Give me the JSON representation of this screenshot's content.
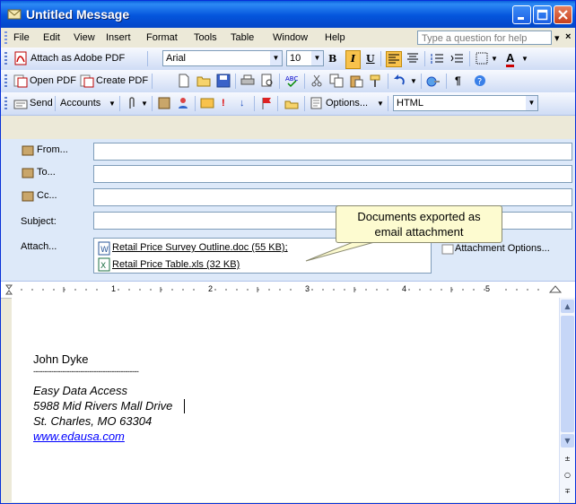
{
  "window": {
    "title": "Untitled Message"
  },
  "menu": [
    "File",
    "Edit",
    "View",
    "Insert",
    "Format",
    "Tools",
    "Table",
    "Window",
    "Help"
  ],
  "ask_placeholder": "Type a question for help",
  "toolbar1": {
    "attach_pdf": "Attach as Adobe PDF",
    "font": "Arial",
    "size": "10"
  },
  "toolbar2": {
    "open_pdf": "Open PDF",
    "create_pdf": "Create PDF"
  },
  "toolbar3": {
    "send": "Send",
    "accounts": "Accounts",
    "options": "Options...",
    "format": "HTML"
  },
  "header": {
    "from": "From...",
    "to": "To...",
    "cc": "Cc...",
    "subject": "Subject:",
    "attach": "Attach...",
    "attachments": [
      "Retail Price Survey Outline.doc (55 KB);",
      "Retail Price Table.xls (32 KB)"
    ],
    "attachment_options": "Attachment Options..."
  },
  "callout": {
    "line1": "Documents exported as",
    "line2": "email attachment"
  },
  "ruler": [
    "1",
    "2",
    "3",
    "4",
    "5"
  ],
  "signature": {
    "name": "John Dyke",
    "divider": "-----------------------------------------------",
    "company": "Easy Data Access",
    "address": "5988 Mid Rivers Mall Drive",
    "city": "St. Charles, MO 63304",
    "website": "www.edausa.com"
  }
}
